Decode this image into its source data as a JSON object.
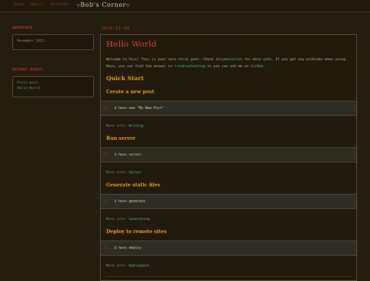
{
  "nav": {
    "items": [
      "Home",
      "About",
      "Archive"
    ],
    "right": "|"
  },
  "site": {
    "title": "Bob's Corner"
  },
  "sidebar": {
    "archives_heading": "ARCHIVES",
    "archives": [
      "November 2023"
    ],
    "recent_heading": "RECENT POSTS",
    "recent": [
      "First post",
      "Hello World"
    ]
  },
  "post": {
    "date": "2023-11-08",
    "title": "Hello World",
    "intro": {
      "t1": "Welcome to ",
      "hexo": "Hexo",
      "t2": "! This is your very first post. Check ",
      "docs": "documentation",
      "t3": " for more info. If you get any problems when using Hexo, you can find the answer in ",
      "trouble": "troubleshooting",
      "t4": " or you can ask me on ",
      "github": "GitHub",
      "t5": "."
    },
    "quick_start": "Quick Start",
    "more_prefix": "More info: ",
    "sections": [
      {
        "title": "Create a new post",
        "code": "$ hexo new \"My New Post\"",
        "link": "Writing"
      },
      {
        "title": "Run server",
        "code": "$ hexo server",
        "link": "Server"
      },
      {
        "title": "Generate static files",
        "code": "$ hexo generate",
        "link": "Generating"
      },
      {
        "title": "Deploy to remote sites",
        "code": "$ hexo deploy",
        "link": "Deployment"
      }
    ],
    "line_number": "1"
  },
  "colors": {
    "background": "#241d10",
    "nav_link": "#8a2d26",
    "heading_red": "#e04032",
    "heading_orange": "#e79a1c",
    "link_teal": "#58a6a0",
    "link_green": "#6f8e4c"
  }
}
